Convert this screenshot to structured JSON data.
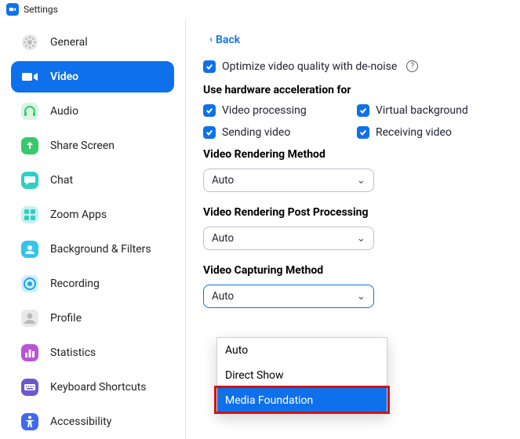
{
  "window": {
    "title": "Settings"
  },
  "sidebar": {
    "items": [
      {
        "label": "General"
      },
      {
        "label": "Video"
      },
      {
        "label": "Audio"
      },
      {
        "label": "Share Screen"
      },
      {
        "label": "Chat"
      },
      {
        "label": "Zoom Apps"
      },
      {
        "label": "Background & Filters"
      },
      {
        "label": "Recording"
      },
      {
        "label": "Profile"
      },
      {
        "label": "Statistics"
      },
      {
        "label": "Keyboard Shortcuts"
      },
      {
        "label": "Accessibility"
      }
    ],
    "active_index": 1
  },
  "content": {
    "back_label": "Back",
    "optimize_label": "Optimize video quality with de-noise",
    "hw_accel_heading": "Use hardware acceleration for",
    "hw_accel": {
      "video_processing": "Video processing",
      "virtual_background": "Virtual background",
      "sending_video": "Sending video",
      "receiving_video": "Receiving video"
    },
    "rendering_method_heading": "Video Rendering Method",
    "rendering_method_value": "Auto",
    "post_processing_heading": "Video Rendering Post Processing",
    "post_processing_value": "Auto",
    "capturing_method_heading": "Video Capturing Method",
    "capturing_method_value": "Auto",
    "capturing_method_options": [
      "Auto",
      "Direct Show",
      "Media Foundation"
    ],
    "capturing_method_highlight_index": 2
  }
}
